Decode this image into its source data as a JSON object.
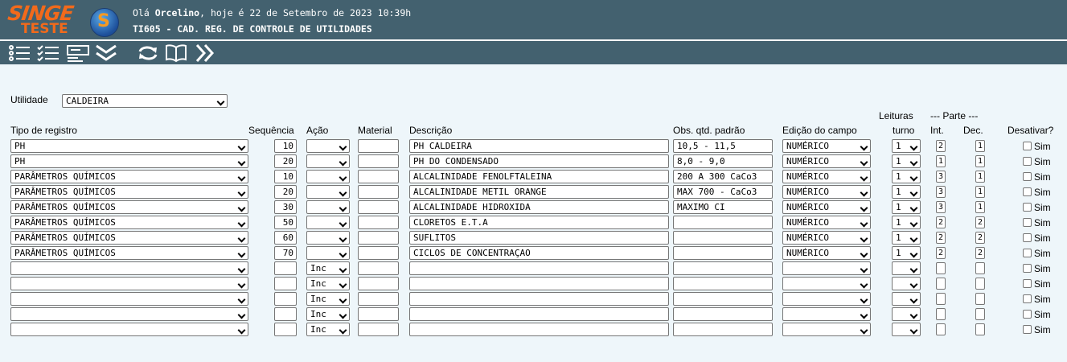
{
  "header": {
    "logo_line1": "SINGE",
    "logo_line2": "TESTE",
    "logo_badge": "S",
    "greeting_prefix": "Olá ",
    "user": "Orcelino",
    "greeting_suffix": ", hoje é 22 de Setembro de 2023 10:39h",
    "screen_title": "TI605 - CAD. REG. DE CONTROLE DE UTILIDADES"
  },
  "toolbar": {
    "icons": [
      "list-icon",
      "checklist-icon",
      "form-icon",
      "double-chevron-down-icon",
      "refresh-icon",
      "book-icon",
      "double-chevron-right-icon"
    ]
  },
  "filter": {
    "label": "Utilidade",
    "value": "CALDEIRA"
  },
  "columns": {
    "tipo": "Tipo de registro",
    "sequencia": "Sequência",
    "acao": "Ação",
    "material": "Material",
    "descricao": "Descrição",
    "obs": "Obs. qtd. padrão",
    "edicao": "Edição do campo",
    "leituras_top": "Leituras",
    "leituras_bottom": "turno",
    "parte": "--- Parte ---",
    "int": "Int.",
    "dec": "Dec.",
    "desativar": "Desativar?"
  },
  "rows": [
    {
      "tipo": "PH",
      "seq": "10",
      "acao": "",
      "material": "",
      "descricao": "PH CALDEIRA",
      "obs": "10,5 - 11,5",
      "edicao": "NUMÉRICO",
      "leituras": "1",
      "int": "2",
      "dec": "1",
      "sim": "Sim"
    },
    {
      "tipo": "PH",
      "seq": "20",
      "acao": "",
      "material": "",
      "descricao": "PH DO CONDENSADO",
      "obs": "8,0 - 9,0",
      "edicao": "NUMÉRICO",
      "leituras": "1",
      "int": "1",
      "dec": "1",
      "sim": "Sim"
    },
    {
      "tipo": "PARÂMETROS QUÍMICOS",
      "seq": "10",
      "acao": "",
      "material": "",
      "descricao": "ALCALINIDADE FENOLFTALEINA",
      "obs": "200 A 300 CaCo3",
      "edicao": "NUMÉRICO",
      "leituras": "1",
      "int": "3",
      "dec": "1",
      "sim": "Sim"
    },
    {
      "tipo": "PARÂMETROS QUÍMICOS",
      "seq": "20",
      "acao": "",
      "material": "",
      "descricao": "ALCALINIDADE METIL ORANGE",
      "obs": "MAX 700 - CaCo3",
      "edicao": "NUMÉRICO",
      "leituras": "1",
      "int": "3",
      "dec": "1",
      "sim": "Sim"
    },
    {
      "tipo": "PARÂMETROS QUÍMICOS",
      "seq": "30",
      "acao": "",
      "material": "",
      "descricao": "ALCALINIDADE HIDROXIDA",
      "obs": "MAXIMO CI",
      "edicao": "NUMÉRICO",
      "leituras": "1",
      "int": "3",
      "dec": "1",
      "sim": "Sim"
    },
    {
      "tipo": "PARÂMETROS QUÍMICOS",
      "seq": "50",
      "acao": "",
      "material": "",
      "descricao": "CLORETOS E.T.A",
      "obs": "",
      "edicao": "NUMÉRICO",
      "leituras": "1",
      "int": "2",
      "dec": "2",
      "sim": "Sim"
    },
    {
      "tipo": "PARÂMETROS QUÍMICOS",
      "seq": "60",
      "acao": "",
      "material": "",
      "descricao": "SUFLITOS",
      "obs": "",
      "edicao": "NUMÉRICO",
      "leituras": "1",
      "int": "2",
      "dec": "2",
      "sim": "Sim"
    },
    {
      "tipo": "PARÂMETROS QUÍMICOS",
      "seq": "70",
      "acao": "",
      "material": "",
      "descricao": "CICLOS DE CONCENTRAÇAO",
      "obs": "",
      "edicao": "NUMÉRICO",
      "leituras": "1",
      "int": "2",
      "dec": "2",
      "sim": "Sim"
    },
    {
      "tipo": "",
      "seq": "",
      "acao": "Inc",
      "material": "",
      "descricao": "",
      "obs": "",
      "edicao": "",
      "leituras": "",
      "int": "",
      "dec": "",
      "sim": "Sim"
    },
    {
      "tipo": "",
      "seq": "",
      "acao": "Inc",
      "material": "",
      "descricao": "",
      "obs": "",
      "edicao": "",
      "leituras": "",
      "int": "",
      "dec": "",
      "sim": "Sim"
    },
    {
      "tipo": "",
      "seq": "",
      "acao": "Inc",
      "material": "",
      "descricao": "",
      "obs": "",
      "edicao": "",
      "leituras": "",
      "int": "",
      "dec": "",
      "sim": "Sim"
    },
    {
      "tipo": "",
      "seq": "",
      "acao": "Inc",
      "material": "",
      "descricao": "",
      "obs": "",
      "edicao": "",
      "leituras": "",
      "int": "",
      "dec": "",
      "sim": "Sim"
    },
    {
      "tipo": "",
      "seq": "",
      "acao": "Inc",
      "material": "",
      "descricao": "",
      "obs": "",
      "edicao": "",
      "leituras": "",
      "int": "",
      "dec": "",
      "sim": "Sim"
    }
  ]
}
